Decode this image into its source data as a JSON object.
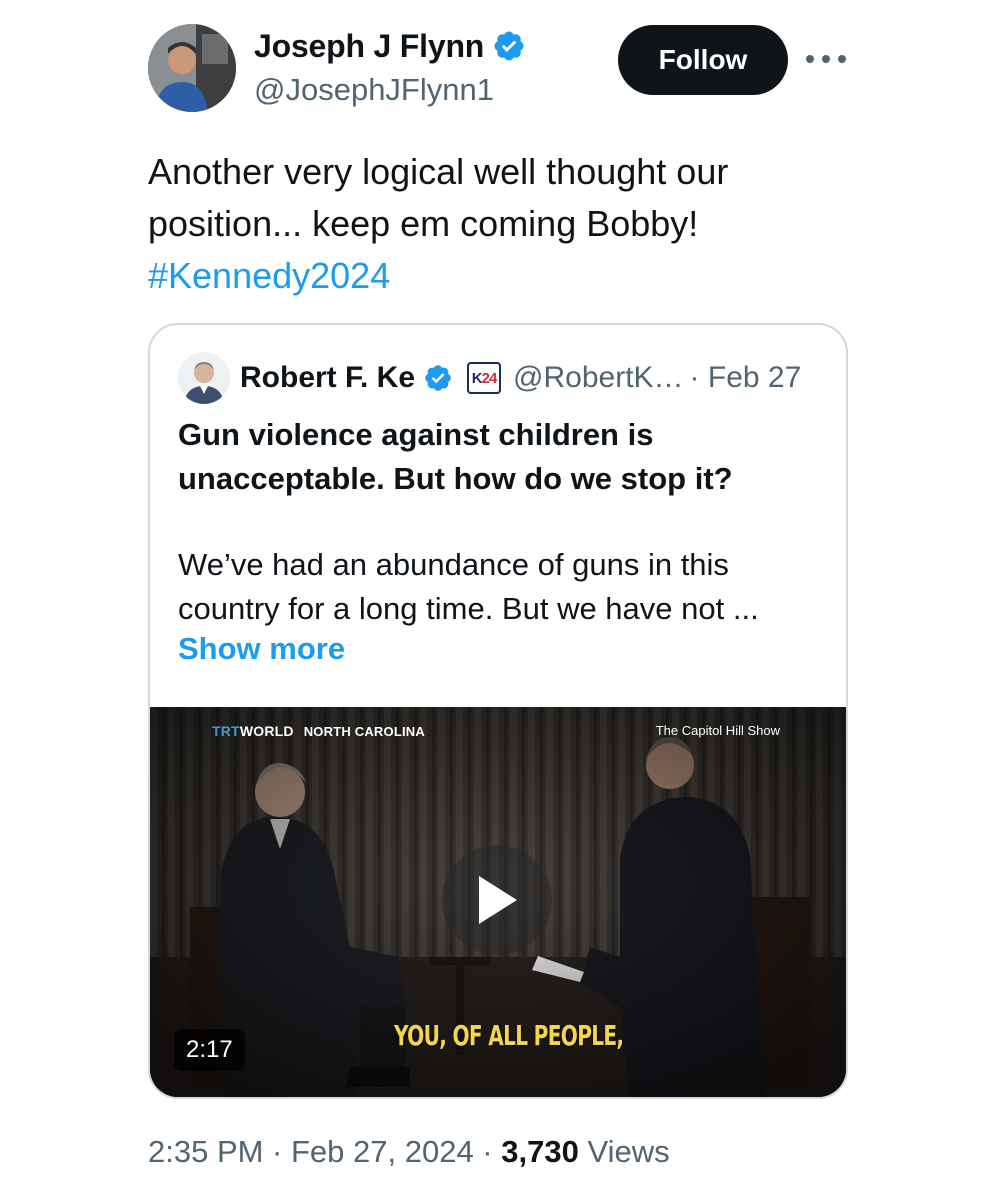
{
  "author": {
    "display_name": "Joseph J Flynn",
    "handle": "@JosephJFlynn1",
    "verified_icon": "verified-badge-icon"
  },
  "actions": {
    "follow_label": "Follow",
    "more_icon": "more-horizontal-icon"
  },
  "tweet": {
    "text_line1": "Another very logical well thought our",
    "text_line2": "position... keep em coming Bobby!",
    "hashtag": "#Kennedy2024"
  },
  "quote": {
    "display_name": "Robert F. Ke",
    "badge_text_a": "K",
    "badge_text_b": "24",
    "handle": "@RobertK…",
    "date": "· Feb 27",
    "title_line1": "Gun violence against children is",
    "title_line2": "unacceptable. But how do we stop it?",
    "body_line1": "We’ve had an abundance of guns in this",
    "body_line2": "country for a long time. But we have not ...",
    "show_more": "Show more"
  },
  "video": {
    "brand_a": "TRT",
    "brand_b": "WORLD",
    "location": "NORTH CAROLINA",
    "show_name": "The Capitol Hill Show",
    "subtitle": "YOU, OF ALL PEOPLE,",
    "duration": "2:17"
  },
  "meta": {
    "time_date": "2:35 PM · Feb 27, 2024 ·",
    "views_count": "3,730",
    "views_label": "Views"
  },
  "colors": {
    "accent": "#1d9bf0",
    "text": "#0f1419",
    "muted": "#536471",
    "border": "#cfd9de"
  }
}
